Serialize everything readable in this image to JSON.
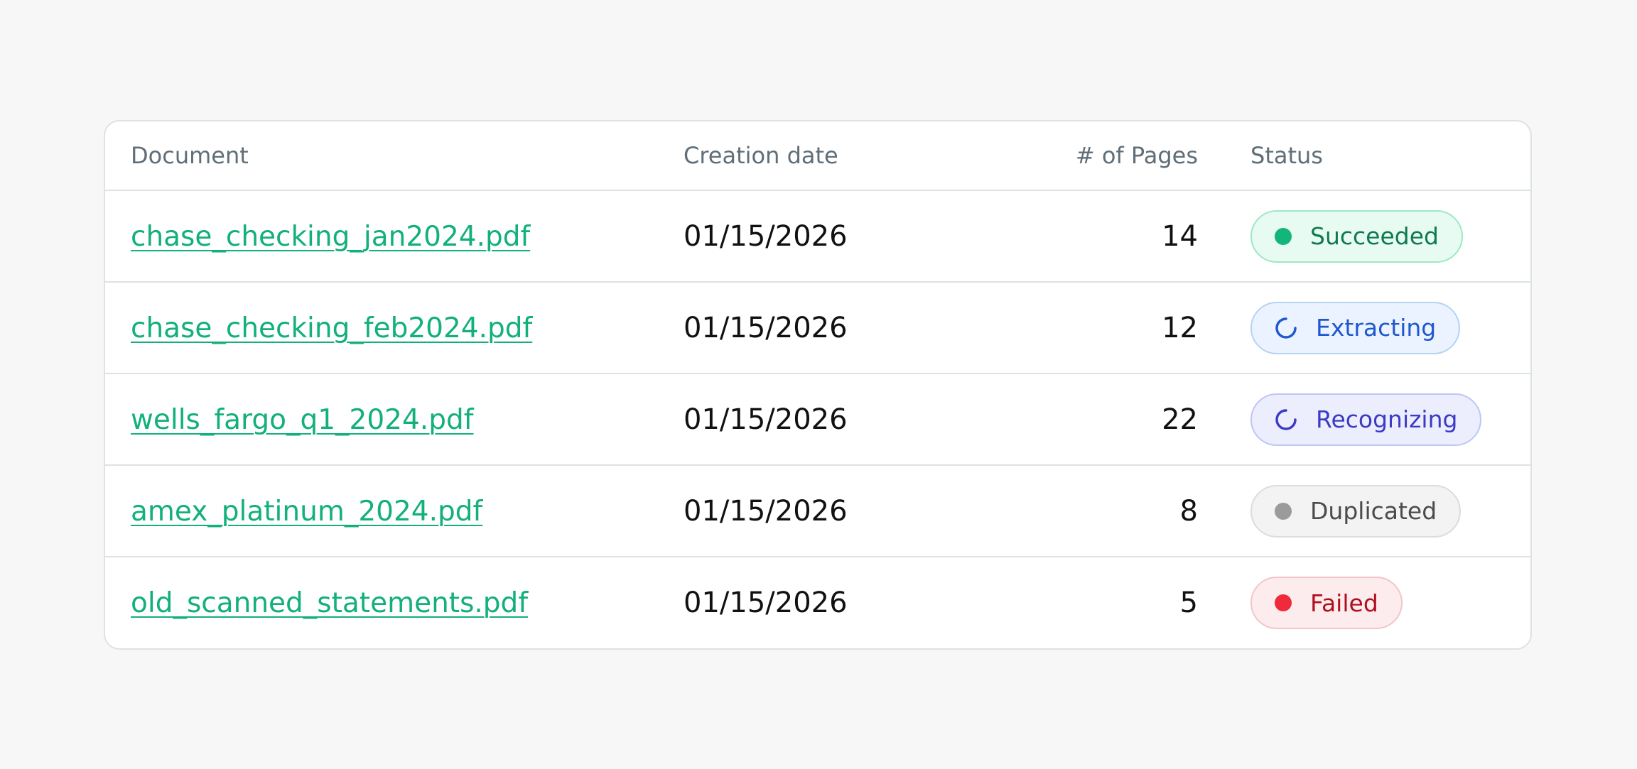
{
  "table": {
    "headers": {
      "document": "Document",
      "creation_date": "Creation date",
      "pages": "# of Pages",
      "status": "Status"
    },
    "rows": [
      {
        "document": "chase_checking_jan2024.pdf",
        "creation_date": "01/15/2026",
        "pages": "14",
        "status": "Succeeded"
      },
      {
        "document": "chase_checking_feb2024.pdf",
        "creation_date": "01/15/2026",
        "pages": "12",
        "status": "Extracting"
      },
      {
        "document": "wells_fargo_q1_2024.pdf",
        "creation_date": "01/15/2026",
        "pages": "22",
        "status": "Recognizing"
      },
      {
        "document": "amex_platinum_2024.pdf",
        "creation_date": "01/15/2026",
        "pages": "8",
        "status": "Duplicated"
      },
      {
        "document": "old_scanned_statements.pdf",
        "creation_date": "01/15/2026",
        "pages": "5",
        "status": "Failed"
      }
    ]
  },
  "colors": {
    "link": "#12b07a",
    "succeeded": "#14b57b",
    "extracting": "#1f57cf",
    "recognizing": "#3b3bc4",
    "duplicated": "#9b9b9b",
    "failed": "#ef2b3b"
  },
  "icons": {
    "succeeded": "dot-icon",
    "extracting": "spinner-icon",
    "recognizing": "spinner-icon",
    "duplicated": "dot-icon",
    "failed": "dot-icon"
  }
}
